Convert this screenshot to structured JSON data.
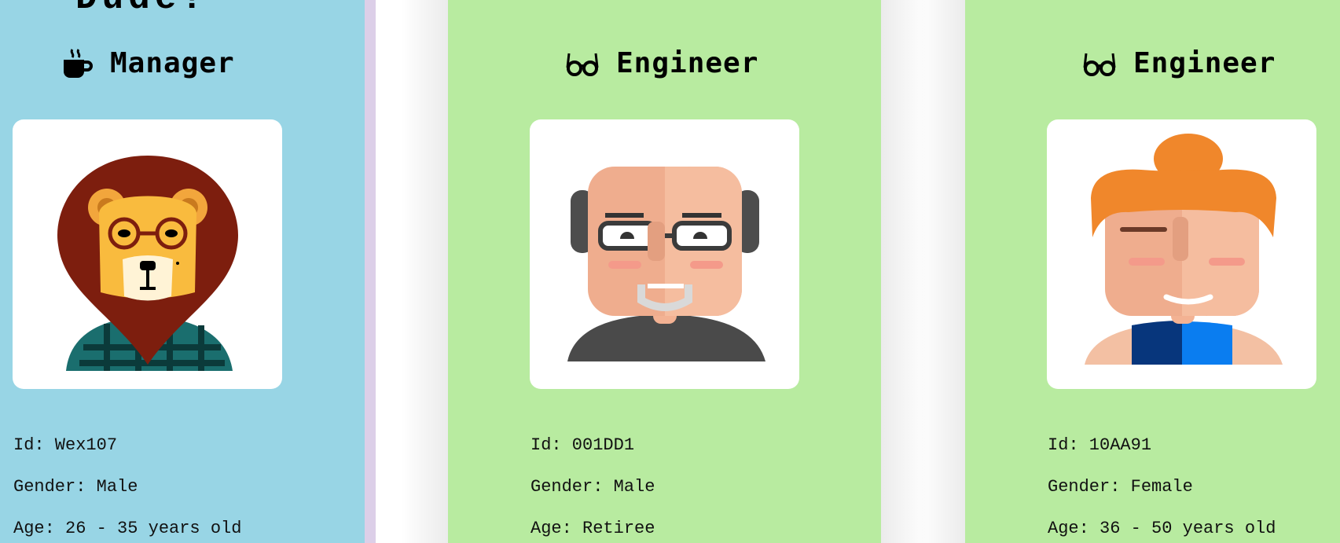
{
  "cards": [
    {
      "heading_fragment": "Dude!",
      "role": "Manager",
      "role_icon": "coffee-mug-icon",
      "avatar": "lion-with-glasses-avatar",
      "bg_color": "#98d5e5",
      "id_label": "Id: Wex107",
      "gender_label": "Gender: Male",
      "age_label": "Age: 26 - 35 years old"
    },
    {
      "role": "Engineer",
      "role_icon": "glasses-icon",
      "avatar": "bald-man-with-glasses-avatar",
      "bg_color": "#b8eba0",
      "id_label": "Id: 001DD1",
      "gender_label": "Gender: Male",
      "age_label": "Age: Retiree"
    },
    {
      "role": "Engineer",
      "role_icon": "glasses-icon",
      "avatar": "red-haired-woman-avatar",
      "bg_color": "#b8eba0",
      "id_label": "Id: 10AA91",
      "gender_label": "Gender: Female",
      "age_label": "Age: 36 - 50 years old"
    }
  ]
}
